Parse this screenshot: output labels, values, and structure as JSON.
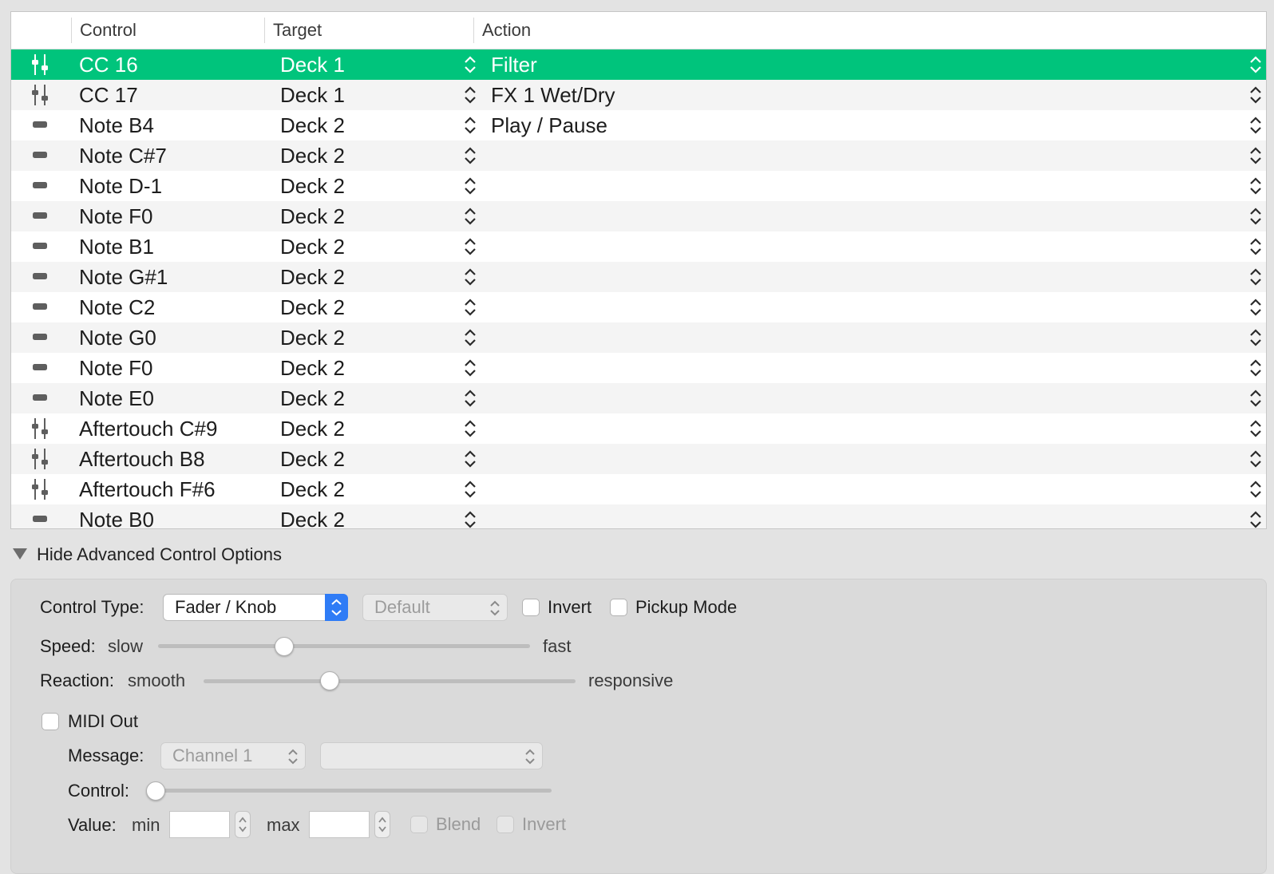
{
  "table": {
    "columns": {
      "control": "Control",
      "target": "Target",
      "action": "Action"
    },
    "rows": [
      {
        "icon": "fader",
        "control": "CC 16",
        "target": "Deck 1",
        "action": "Filter",
        "selected": true
      },
      {
        "icon": "fader",
        "control": "CC 17",
        "target": "Deck 1",
        "action": "FX 1 Wet/Dry"
      },
      {
        "icon": "button",
        "control": "Note B4",
        "target": "Deck 2",
        "action": "Play / Pause"
      },
      {
        "icon": "button",
        "control": "Note C#7",
        "target": "Deck 2",
        "action": ""
      },
      {
        "icon": "button",
        "control": "Note D-1",
        "target": "Deck 2",
        "action": ""
      },
      {
        "icon": "button",
        "control": "Note F0",
        "target": "Deck 2",
        "action": ""
      },
      {
        "icon": "button",
        "control": "Note B1",
        "target": "Deck 2",
        "action": ""
      },
      {
        "icon": "button",
        "control": "Note G#1",
        "target": "Deck 2",
        "action": ""
      },
      {
        "icon": "button",
        "control": "Note C2",
        "target": "Deck 2",
        "action": ""
      },
      {
        "icon": "button",
        "control": "Note G0",
        "target": "Deck 2",
        "action": ""
      },
      {
        "icon": "button",
        "control": "Note F0",
        "target": "Deck 2",
        "action": ""
      },
      {
        "icon": "button",
        "control": "Note E0",
        "target": "Deck 2",
        "action": ""
      },
      {
        "icon": "fader",
        "control": "Aftertouch C#9",
        "target": "Deck 2",
        "action": ""
      },
      {
        "icon": "fader",
        "control": "Aftertouch B8",
        "target": "Deck 2",
        "action": ""
      },
      {
        "icon": "fader",
        "control": "Aftertouch F#6",
        "target": "Deck 2",
        "action": ""
      },
      {
        "icon": "button",
        "control": "Note B0",
        "target": "Deck 2",
        "action": ""
      }
    ]
  },
  "advanced": {
    "toggle_label": "Hide Advanced Control Options",
    "control_type_label": "Control Type:",
    "control_type_value": "Fader / Knob",
    "mode_value": "Default",
    "invert_label": "Invert",
    "pickup_label": "Pickup Mode",
    "speed_label": "Speed:",
    "speed_min": "slow",
    "speed_max": "fast",
    "speed_level": 0.34,
    "reaction_label": "Reaction:",
    "reaction_min": "smooth",
    "reaction_max": "responsive",
    "reaction_level": 0.34,
    "midi_out_label": "MIDI Out",
    "message_label": "Message:",
    "message_channel": "Channel 1",
    "message_type": "",
    "control_label": "Control:",
    "control_level": 0,
    "value_label": "Value:",
    "min_label": "min",
    "max_label": "max",
    "min_value": "",
    "max_value": "",
    "blend_label": "Blend",
    "invert2_label": "Invert"
  },
  "colors": {
    "selection": "#00c47c",
    "accent": "#2f7cf6"
  }
}
